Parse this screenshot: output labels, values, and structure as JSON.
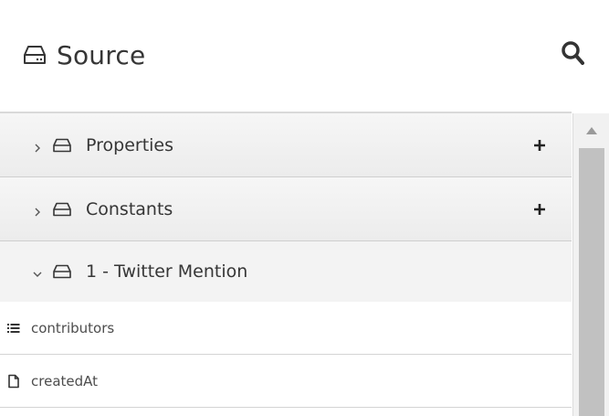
{
  "header": {
    "title": "Source",
    "title_icon": "source-tray-icon",
    "search_icon": "search-icon"
  },
  "tree": {
    "groups": [
      {
        "label": "Properties",
        "expanded": false,
        "add_icon": "plus-icon"
      },
      {
        "label": "Constants",
        "expanded": false,
        "add_icon": "plus-icon"
      },
      {
        "label": "1 - Twitter Mention",
        "expanded": true
      }
    ],
    "fields": [
      {
        "label": "contributors",
        "icon": "list-icon"
      },
      {
        "label": "createdAt",
        "icon": "document-icon"
      }
    ]
  },
  "colors": {
    "text": "#363636",
    "group_bg": "#efefef",
    "scroll_thumb": "#c1c1c1"
  }
}
